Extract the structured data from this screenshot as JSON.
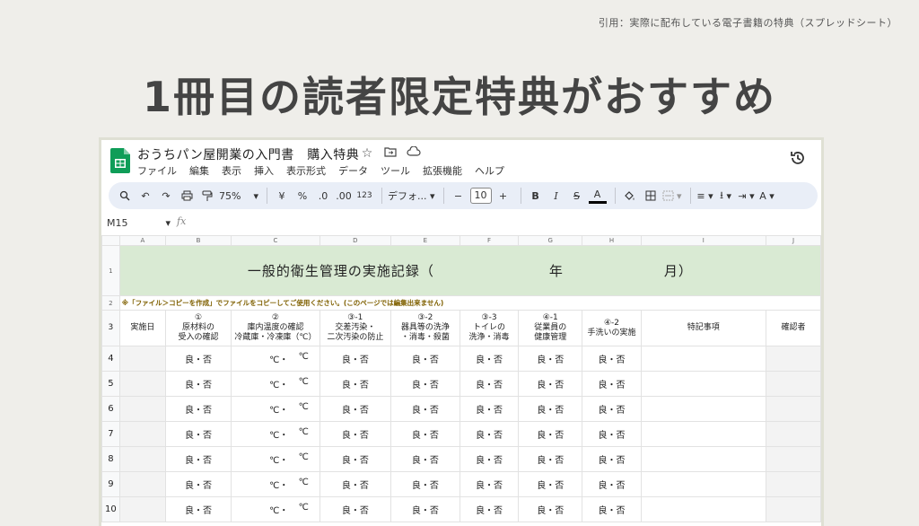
{
  "citation": "引用：実際に配布している電子書籍の特典（スプレッドシート）",
  "headline": "1冊目の読者限定特典がおすすめ",
  "app": {
    "doc_title": "おうちパン屋開業の入門書　購入特典",
    "title_icons": [
      "star-icon",
      "folder-move-icon",
      "cloud-status-icon"
    ],
    "menu": [
      "ファイル",
      "編集",
      "表示",
      "挿入",
      "表示形式",
      "データ",
      "ツール",
      "拡張機能",
      "ヘルプ"
    ],
    "toolbar": {
      "zoom": "75%",
      "currency": "¥",
      "percent": "%",
      "dec_decrease": ".0",
      "dec_increase": ".00",
      "number_format": "123",
      "font": "デフォ...",
      "font_size": "10"
    },
    "cell_ref": "M15",
    "fx": "fx",
    "brand_color": "#0f9d58",
    "band_color": "#d9ead3"
  },
  "sheet": {
    "columns": [
      "A",
      "B",
      "C",
      "D",
      "E",
      "F",
      "G",
      "H",
      "I",
      "J"
    ],
    "rows": [
      "1",
      "2",
      "3",
      "4",
      "5",
      "6",
      "7",
      "8",
      "9",
      "10"
    ],
    "title": "一般的衛生管理の実施記録（　　　　　　　　年　　　　　　　月）",
    "note": "※「ファイル＞コピーを作成」でファイルをコピーしてご使用ください。(このページでは編集出来ません)",
    "headers": [
      {
        "l1": "実施日",
        "l2": ""
      },
      {
        "l1": "①",
        "l2": "原材料の",
        "l3": "受入の確認"
      },
      {
        "l1": "②",
        "l2": "庫内温度の確認",
        "l3": "冷蔵庫・冷凍庫（℃）"
      },
      {
        "l1": "③-1",
        "l2": "交差汚染・",
        "l3": "二次汚染の防止"
      },
      {
        "l1": "③-2",
        "l2": "器具等の洗浄",
        "l3": "・消毒・殺菌"
      },
      {
        "l1": "③-3",
        "l2": "トイレの",
        "l3": "洗浄・消毒"
      },
      {
        "l1": "④-1",
        "l2": "従業員の",
        "l3": "健康管理"
      },
      {
        "l1": "④-2",
        "l2": "手洗いの実施",
        "l3": ""
      },
      {
        "l1": "特記事項",
        "l2": "",
        "l3": ""
      },
      {
        "l1": "確認者",
        "l2": "",
        "l3": ""
      }
    ],
    "cell_ok": "良・否",
    "temp_a": "℃・",
    "temp_b": "℃"
  }
}
